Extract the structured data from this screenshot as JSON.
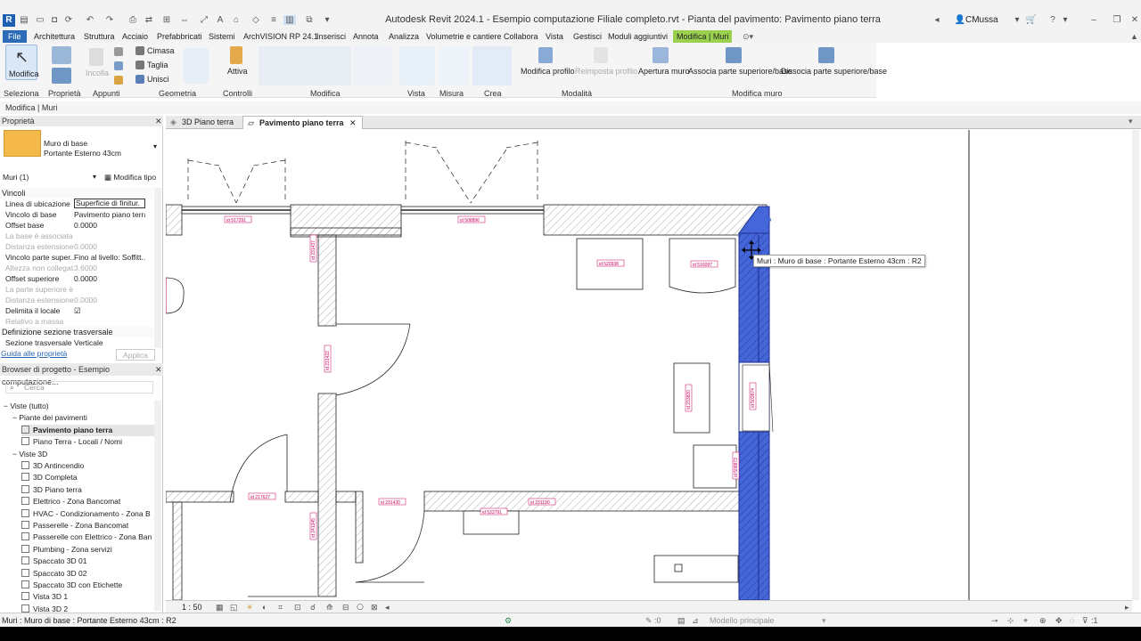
{
  "window": {
    "title": "Autodesk Revit 2024.1 - Esempio computazione Filiale completo.rvt - Pianta del pavimento: Pavimento piano terra",
    "user": "CMussa",
    "logo": "R"
  },
  "menu": [
    "File",
    "Architettura",
    "Struttura",
    "Acciaio",
    "Prefabbricati",
    "Sistemi",
    "ArchVISION RP 24.1",
    "Inserisci",
    "Annota",
    "Analizza",
    "Volumetrie e cantiere",
    "Collabora",
    "Vista",
    "Gestisci",
    "Moduli aggiuntivi",
    "Modifica | Muri"
  ],
  "ribbon": {
    "modifica_label": "Modifica",
    "cimasa": "Cimasa",
    "taglia": "Taglia",
    "unisci": "Unisci",
    "attiva": "Attiva",
    "incolla": "Incolla",
    "panels": {
      "selezione": "Seleziona",
      "proprieta": "Proprietà",
      "appunti": "Appunti",
      "geometria": "Geometria",
      "controlli": "Controlli",
      "modifica": "Modifica",
      "vista": "Vista",
      "misura": "Misura",
      "crea": "Crea",
      "modalita": "Modalità",
      "modifica_muro": "Modifica muro"
    },
    "modifica_profilo": "Modifica profilo",
    "reimposta_profilo": "Reimposta profilo",
    "apertura_muro": "Apertura muro",
    "associa": "Associa parte superiore/base",
    "dissocia": "Dissocia parte superiore/base"
  },
  "context_bar": "Modifica | Muri",
  "properties": {
    "title": "Proprietà",
    "type_name": "Muro di base",
    "type_sub": "Portante Esterno 43cm",
    "filter": "Muri (1)",
    "edit_type": "Modifica tipo",
    "cat_vincoli": "Vincoli",
    "rows": [
      {
        "k": "Linea di ubicazione",
        "v": "Superficie di finitur.",
        "dis": false
      },
      {
        "k": "Vincolo di base",
        "v": "Pavimento piano terra",
        "dis": false
      },
      {
        "k": "Offset base",
        "v": "0.0000",
        "dis": false
      },
      {
        "k": "La base è associata",
        "v": "",
        "dis": true
      },
      {
        "k": "Distanza estensione...",
        "v": "0.0000",
        "dis": true
      },
      {
        "k": "Vincolo parte super...",
        "v": "Fino al livello: Soffitt...",
        "dis": false
      },
      {
        "k": "Altezza non collegata",
        "v": "3.6000",
        "dis": true
      },
      {
        "k": "Offset superiore",
        "v": "0.0000",
        "dis": false
      },
      {
        "k": "La parte superiore è...",
        "v": "",
        "dis": true
      },
      {
        "k": "Distanza estensione...",
        "v": "0.0000",
        "dis": true
      },
      {
        "k": "Delimita il locale",
        "v": "☑",
        "dis": false
      },
      {
        "k": "Relativo a massa",
        "v": "",
        "dis": true
      }
    ],
    "cat_sezione": "Definizione sezione trasversale",
    "sezione_row": {
      "k": "Sezione trasversale",
      "v": "Verticale"
    },
    "help_link": "Guida alle proprietà",
    "apply": "Applica"
  },
  "browser": {
    "title": "Browser di progetto - Esempio computazione...",
    "search_placeholder": "Cerca",
    "items": [
      {
        "label": "Viste (tutto)",
        "level": 0,
        "type": "group"
      },
      {
        "label": "Piante dei pavimenti",
        "level": 1,
        "type": "group"
      },
      {
        "label": "Pavimento piano terra",
        "level": 2,
        "type": "view",
        "active": true
      },
      {
        "label": "Piano Terra - Locali / Nomi",
        "level": 2,
        "type": "view"
      },
      {
        "label": "Viste 3D",
        "level": 1,
        "type": "group"
      },
      {
        "label": "3D Antincendio",
        "level": 2,
        "type": "view"
      },
      {
        "label": "3D Completa",
        "level": 2,
        "type": "view"
      },
      {
        "label": "3D Piano terra",
        "level": 2,
        "type": "view"
      },
      {
        "label": "Elettrico - Zona Bancomat",
        "level": 2,
        "type": "view"
      },
      {
        "label": "HVAC - Condizionamento - Zona B",
        "level": 2,
        "type": "view"
      },
      {
        "label": "Passerelle - Zona Bancomat",
        "level": 2,
        "type": "view"
      },
      {
        "label": "Passerelle con Elettrico - Zona Ban",
        "level": 2,
        "type": "view"
      },
      {
        "label": "Plumbing - Zona servizi",
        "level": 2,
        "type": "view"
      },
      {
        "label": "Spaccato 3D 01",
        "level": 2,
        "type": "view"
      },
      {
        "label": "Spaccato 3D 02",
        "level": 2,
        "type": "view"
      },
      {
        "label": "Spaccato 3D con Etichette",
        "level": 2,
        "type": "view"
      },
      {
        "label": "Vista 3D 1",
        "level": 2,
        "type": "view"
      },
      {
        "label": "Vista 3D 2",
        "level": 2,
        "type": "view"
      }
    ]
  },
  "view_tabs": [
    {
      "label": "3D Piano terra",
      "active": false
    },
    {
      "label": "Pavimento piano terra",
      "active": true
    }
  ],
  "canvas": {
    "tooltip": "Muri : Muro di base : Portante Esterno 43cm : R2",
    "tags": [
      "id 517291",
      "id 508896",
      "id 520938",
      "id 516097",
      "id 231422",
      "id 231437",
      "id 233820",
      "id 503874",
      "id 217627",
      "id 231430",
      "id 231190",
      "id 533791",
      "id 241345",
      "id 508873"
    ]
  },
  "view_control": {
    "scale": "1 : 50"
  },
  "status": {
    "text": "Muri : Muro di base : Portante Esterno 43cm : R2",
    "workset_value": ":0",
    "model": "Modello principale",
    "filter_count": ":1"
  },
  "colors": {
    "accent": "#2c6bb7",
    "context_tab": "#9bd14f",
    "selected_wall": "#4466d8"
  }
}
